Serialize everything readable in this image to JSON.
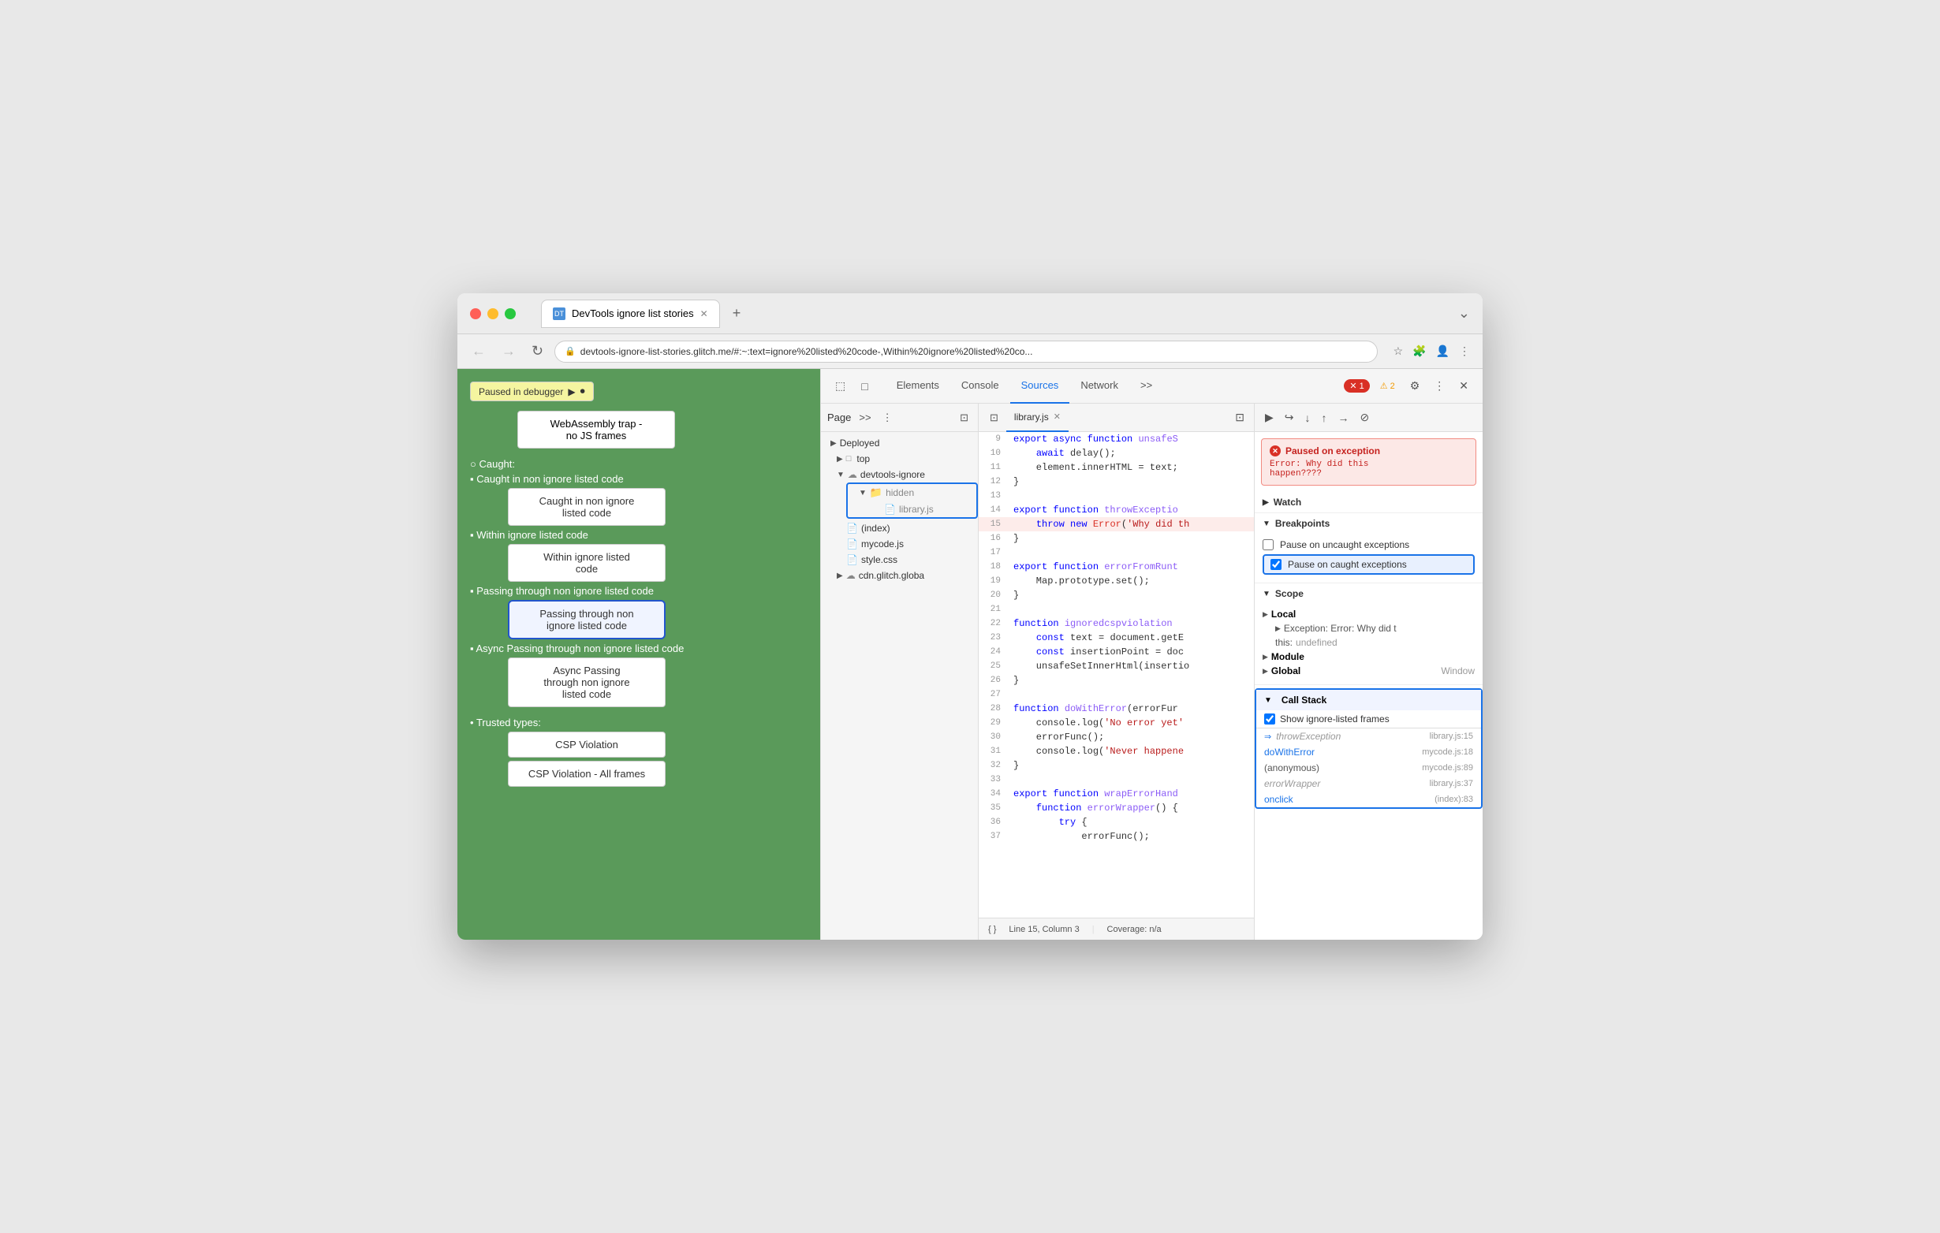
{
  "browser": {
    "tab_title": "DevTools ignore list stories",
    "tab_favicon": "DT",
    "address": "devtools-ignore-list-stories.glitch.me/#:~:text=ignore%20listed%20code-,Within%20ignore%20listed%20co...",
    "new_tab_btn": "+",
    "overflow_btn": "⌄"
  },
  "nav": {
    "back": "←",
    "forward": "→",
    "reload": "↻",
    "home": "⌂"
  },
  "page": {
    "paused_label": "Paused in debugger",
    "webassembly_text": "WebAssembly trap -\nno JS frames",
    "caught_label": "Caught:",
    "items": [
      {
        "label": "Caught in non ignore listed code",
        "btn_label": "Caught in non ignore\nlisted code",
        "selected": false
      },
      {
        "label": "Within ignore listed code",
        "btn_label": "Within ignore listed\ncode",
        "selected": false
      },
      {
        "label": "Passing through non ignore listed code",
        "btn_label": "Passing through non\nignore listed code",
        "selected": true
      },
      {
        "label": "Async Passing through non ignore listed code",
        "btn_label": "Async Passing\nthrough non ignore\nlisted code",
        "selected": false
      }
    ],
    "trusted_types_label": "Trusted types:",
    "csp_violation_btn": "CSP Violation",
    "csp_all_frames_btn": "CSP Violation - All frames"
  },
  "devtools": {
    "toolbar_tools": [
      "⬚",
      "□"
    ],
    "tabs": [
      "Elements",
      "Console",
      "Sources",
      "Network",
      ">>"
    ],
    "active_tab": "Sources",
    "error_count": "1",
    "warning_count": "2",
    "settings_icon": "⚙",
    "more_icon": "⋮",
    "close_icon": "✕"
  },
  "file_tree": {
    "header_btns": [
      "⇥",
      "↗"
    ],
    "page_label": "Page",
    "more_btn": ">>",
    "menu_btn": "⋮",
    "sidebar_btn": "⊡",
    "items": [
      {
        "type": "section",
        "label": "Deployed",
        "level": 0
      },
      {
        "type": "folder",
        "label": "top",
        "level": 1,
        "expanded": false
      },
      {
        "type": "folder",
        "label": "devtools-ignore",
        "level": 1,
        "expanded": true,
        "cloud": true
      },
      {
        "type": "folder",
        "label": "hidden",
        "level": 2,
        "expanded": true,
        "selected_box": true
      },
      {
        "type": "file",
        "label": "library.js",
        "level": 3,
        "selected": true
      },
      {
        "type": "file",
        "label": "(index)",
        "level": 2
      },
      {
        "type": "file",
        "label": "mycode.js",
        "level": 2
      },
      {
        "type": "file",
        "label": "style.css",
        "level": 2
      },
      {
        "type": "folder",
        "label": "cdn.glitch.globa",
        "level": 1,
        "expanded": false,
        "cloud": true
      }
    ]
  },
  "code": {
    "filename": "library.js",
    "close_btn": "✕",
    "lines": [
      {
        "num": 9,
        "text": "export async function unsafeS",
        "highlight": false
      },
      {
        "num": 10,
        "text": "  await delay();",
        "highlight": false
      },
      {
        "num": 11,
        "text": "  element.innerHTML = text;",
        "highlight": false
      },
      {
        "num": 12,
        "text": "}",
        "highlight": false
      },
      {
        "num": 13,
        "text": "",
        "highlight": false
      },
      {
        "num": 14,
        "text": "export function throwExceptio",
        "highlight": false
      },
      {
        "num": 15,
        "text": "  throw new Error('Why did th",
        "highlight": true,
        "error": true
      },
      {
        "num": 16,
        "text": "}",
        "highlight": false
      },
      {
        "num": 17,
        "text": "",
        "highlight": false
      },
      {
        "num": 18,
        "text": "export function errorFromRunt",
        "highlight": false
      },
      {
        "num": 19,
        "text": "  Map.prototype.set();",
        "highlight": false
      },
      {
        "num": 20,
        "text": "}",
        "highlight": false
      },
      {
        "num": 21,
        "text": "",
        "highlight": false
      },
      {
        "num": 22,
        "text": "function ignoredcspviolation",
        "highlight": false
      },
      {
        "num": 23,
        "text": "  const text = document.getE",
        "highlight": false
      },
      {
        "num": 24,
        "text": "  const insertionPoint = doc",
        "highlight": false
      },
      {
        "num": 25,
        "text": "  unsafeSetInnerHtml(insertio",
        "highlight": false
      },
      {
        "num": 26,
        "text": "}",
        "highlight": false
      },
      {
        "num": 27,
        "text": "",
        "highlight": false
      },
      {
        "num": 28,
        "text": "function doWithError(errorFur",
        "highlight": false
      },
      {
        "num": 29,
        "text": "  console.log('No error yet'",
        "highlight": false
      },
      {
        "num": 30,
        "text": "  errorFunc();",
        "highlight": false
      },
      {
        "num": 31,
        "text": "  console.log('Never happene",
        "highlight": false
      },
      {
        "num": 32,
        "text": "}",
        "highlight": false
      },
      {
        "num": 33,
        "text": "",
        "highlight": false
      },
      {
        "num": 34,
        "text": "export function wrapErrorHand",
        "highlight": false
      },
      {
        "num": 35,
        "text": "  function errorWrapper() {",
        "highlight": false
      },
      {
        "num": 36,
        "text": "    try {",
        "highlight": false
      },
      {
        "num": 37,
        "text": "      errorFunc();",
        "highlight": false
      }
    ],
    "statusbar_line": "Line 15, Column 3",
    "statusbar_coverage": "Coverage: n/a",
    "statusbar_format": "{ }"
  },
  "right_panel": {
    "resume_btn": "▶",
    "step_over_btn": "↪",
    "step_into_btn": "↓",
    "step_out_btn": "↑",
    "step_btn": "→",
    "deactivate_btn": "⊘",
    "exception": {
      "icon": "✕",
      "title": "Paused on exception",
      "message": "Error: Why did this\nhappen????"
    },
    "watch_label": "Watch",
    "breakpoints": {
      "label": "Breakpoints",
      "pause_uncaught_label": "Pause on uncaught exceptions",
      "pause_caught_label": "Pause on caught exceptions",
      "pause_uncaught_checked": false,
      "pause_caught_checked": true
    },
    "scope": {
      "label": "Scope",
      "local_label": "Local",
      "exception_label": "Exception: Error: Why did t",
      "this_label": "this:",
      "this_value": "undefined",
      "module_label": "Module",
      "global_label": "Global",
      "global_value": "Window"
    },
    "callstack": {
      "label": "Call Stack",
      "show_ignore_label": "Show ignore-listed frames",
      "show_ignore_checked": true,
      "frames": [
        {
          "fn": "throwException",
          "loc": "library.js:15",
          "dimmed": true,
          "current": true
        },
        {
          "fn": "doWithError",
          "loc": "mycode.js:18",
          "dimmed": false
        },
        {
          "fn": "(anonymous)",
          "loc": "mycode.js:89",
          "dimmed": false
        },
        {
          "fn": "errorWrapper",
          "loc": "library.js:37",
          "dimmed": true
        },
        {
          "fn": "onclick",
          "loc": "(index):83",
          "dimmed": false
        }
      ]
    }
  }
}
